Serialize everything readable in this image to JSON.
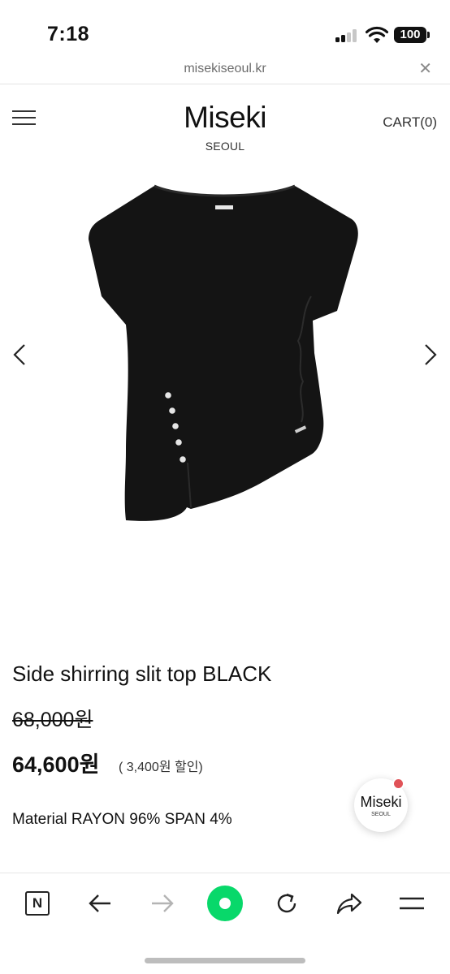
{
  "status_bar": {
    "time": "7:18",
    "battery": "100"
  },
  "browser": {
    "url": "misekiseoul.kr",
    "close_icon": "close-icon"
  },
  "header": {
    "logo_main": "Miseki",
    "logo_sub": "SEOUL",
    "cart_label": "CART(0)",
    "menu_icon": "hamburger-icon"
  },
  "product": {
    "title": "Side shirring slit top BLACK",
    "price_original": "68,000원",
    "price_sale": "64,600원",
    "price_discount": "( 3,400원 할인)",
    "material": "Material RAYON 96% SPAN 4%",
    "image_alt": "black asymmetric cap-sleeve top with side shirring, slit and buttons"
  },
  "float_badge": {
    "main": "Miseki",
    "sub": "SEOUL"
  },
  "toolbar": {
    "icons": [
      "n-logo-icon",
      "back-arrow-icon",
      "forward-arrow-icon",
      "green-home-icon",
      "refresh-icon",
      "share-icon",
      "menu-icon"
    ]
  },
  "colors": {
    "accent_green": "#08d86a",
    "notification_red": "#e05257",
    "text": "#111111"
  }
}
